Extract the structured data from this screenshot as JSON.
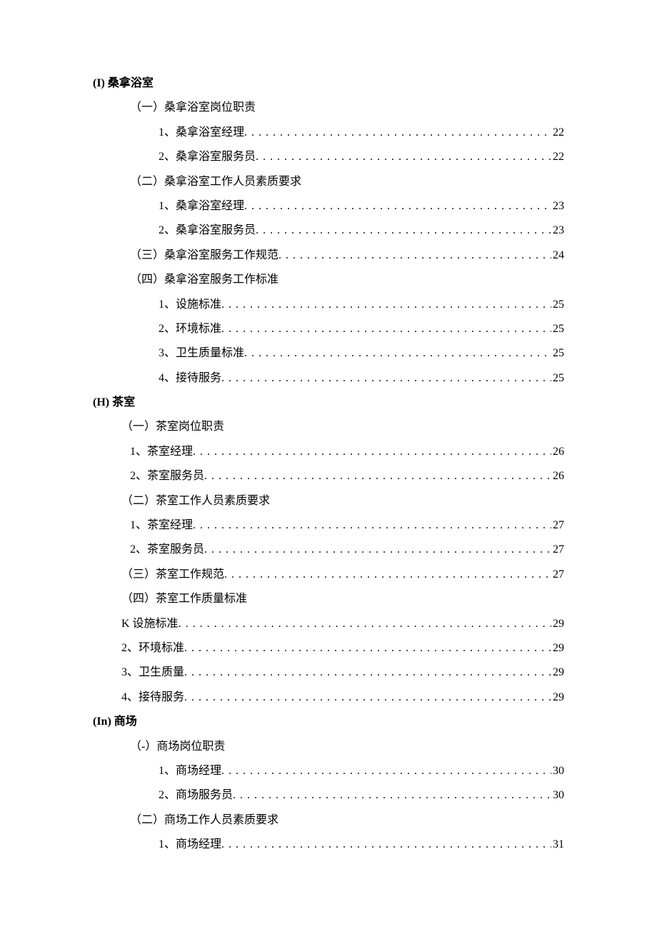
{
  "toc": [
    {
      "label": "(I) 桑拿浴室",
      "indent": "ind0 bold",
      "page": null
    },
    {
      "label": "（一）桑拿浴室岗位职责",
      "indent": "ind1",
      "page": null
    },
    {
      "label": "1、桑拿浴室经理",
      "indent": "ind2",
      "page": "22"
    },
    {
      "label": "2、桑拿浴室服务员",
      "indent": "ind2",
      "page": "22"
    },
    {
      "label": "（二）桑拿浴室工作人员素质要求",
      "indent": "ind1",
      "page": null
    },
    {
      "label": "1、桑拿浴室经理",
      "indent": "ind2",
      "page": "23"
    },
    {
      "label": "2、桑拿浴室服务员",
      "indent": "ind2",
      "page": "23"
    },
    {
      "label": "（三）桑拿浴室服务工作规范",
      "indent": "ind1",
      "page": "24"
    },
    {
      "label": "（四）桑拿浴室服务工作标准",
      "indent": "ind1",
      "page": null
    },
    {
      "label": "1、设施标准",
      "indent": "ind2",
      "page": "25"
    },
    {
      "label": "2、环境标准",
      "indent": "ind2",
      "page": "25"
    },
    {
      "label": "3、卫生质量标准",
      "indent": "ind2",
      "page": "25"
    },
    {
      "label": "4、接待服务",
      "indent": "ind2",
      "page": "25"
    },
    {
      "label": "(H) 茶室",
      "indent": "ind0 bold",
      "page": null
    },
    {
      "label": "（一）茶室岗位职责",
      "indent": "ind1b",
      "page": null
    },
    {
      "label": "1、茶室经理",
      "indent": "ind2b",
      "page": "26"
    },
    {
      "label": "2、茶室服务员",
      "indent": "ind2b",
      "page": "26"
    },
    {
      "label": "（二）茶室工作人员素质要求",
      "indent": "ind1b",
      "page": null
    },
    {
      "label": "1、茶室经理",
      "indent": "ind2b",
      "page": "27"
    },
    {
      "label": "2、茶室服务员",
      "indent": "ind2b",
      "page": "27"
    },
    {
      "label": "（三）茶室工作规范",
      "indent": "ind1b",
      "page": "27"
    },
    {
      "label": "（四）茶室工作质量标准",
      "indent": "ind1b",
      "page": null
    },
    {
      "label": "K 设施标准",
      "indent": "ind1b",
      "page": "29"
    },
    {
      "label": "2、环境标准",
      "indent": "ind1b",
      "page": "29"
    },
    {
      "label": "3、卫生质量",
      "indent": "ind1b",
      "page": "29"
    },
    {
      "label": "4、接待服务",
      "indent": "ind1b",
      "page": "29"
    },
    {
      "label": "(In) 商场",
      "indent": "ind0 bold",
      "page": null
    },
    {
      "label": "（-）商场岗位职责",
      "indent": "ind1",
      "page": null
    },
    {
      "label": "1、商场经理",
      "indent": "ind2",
      "page": "30"
    },
    {
      "label": "2、商场服务员",
      "indent": "ind2",
      "page": "30"
    },
    {
      "label": "（二）商场工作人员素质要求",
      "indent": "ind1",
      "page": null
    },
    {
      "label": "1、商场经理",
      "indent": "ind2",
      "page": "31"
    }
  ]
}
